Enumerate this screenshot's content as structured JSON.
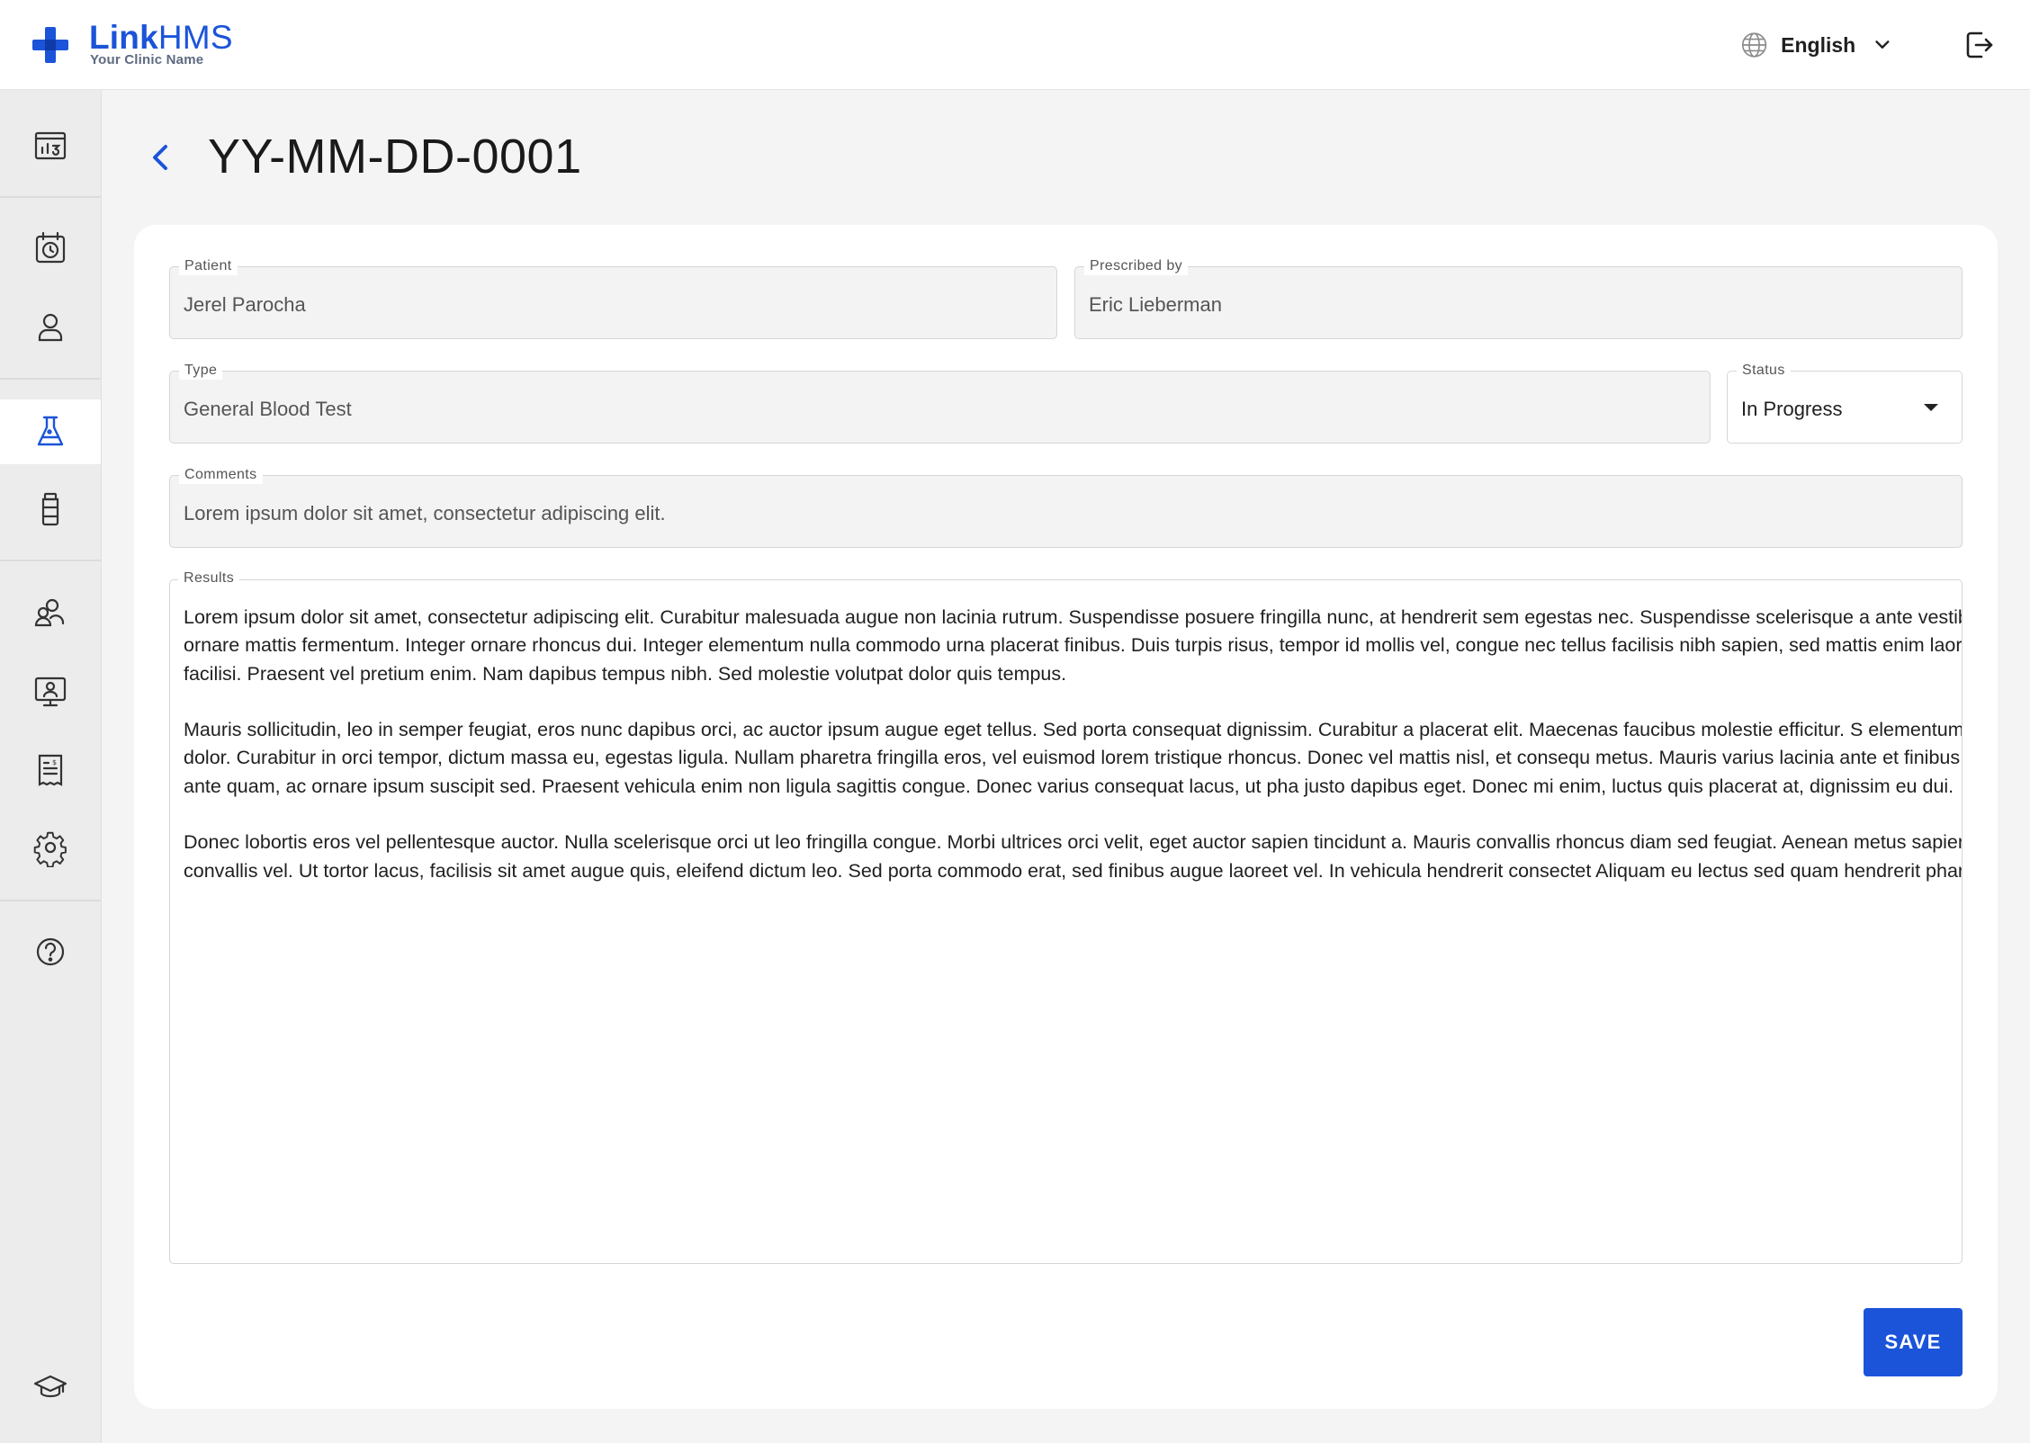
{
  "app": {
    "brand_link": "Link",
    "brand_hms": "HMS",
    "clinic_name": "Your Clinic Name"
  },
  "header": {
    "language": "English"
  },
  "sidebar": {
    "items": [
      {
        "icon": "dashboard-icon"
      },
      {
        "icon": "appointments-icon"
      },
      {
        "icon": "patients-icon"
      },
      {
        "icon": "lab-icon",
        "active": true
      },
      {
        "icon": "pharmacy-icon"
      },
      {
        "icon": "staff-icon"
      },
      {
        "icon": "monitor-icon"
      },
      {
        "icon": "billing-icon"
      },
      {
        "icon": "settings-icon"
      },
      {
        "icon": "help-icon"
      },
      {
        "icon": "education-icon"
      }
    ]
  },
  "page": {
    "title": "YY-MM-DD-0001"
  },
  "form": {
    "patient": {
      "label": "Patient",
      "value": "Jerel Parocha"
    },
    "prescribed_by": {
      "label": "Prescribed by",
      "value": "Eric Lieberman"
    },
    "type": {
      "label": "Type",
      "value": "General Blood Test"
    },
    "status": {
      "label": "Status",
      "value": "In Progress"
    },
    "comments": {
      "label": "Comments",
      "value": "Lorem ipsum dolor sit amet, consectetur adipiscing elit."
    },
    "results": {
      "label": "Results",
      "paragraphs": [
        "Lorem ipsum dolor sit amet, consectetur adipiscing elit. Curabitur malesuada augue non lacinia rutrum. Suspendisse posuere fringilla nunc, at hendrerit sem egestas nec. Suspendisse scelerisque a ante vestibulum mattis. Nulla ornare mattis fermentum. Integer ornare rhoncus dui. Integer elementum nulla commodo urna placerat finibus. Duis turpis risus, tempor id mollis vel, congue nec tellus facilisis nibh sapien, sed mattis enim laoreet sit amet. Nulla facilisi. Praesent vel pretium enim. Nam dapibus tempus nibh. Sed molestie volutpat dolor quis tempus.",
        "Mauris sollicitudin, leo in semper feugiat, eros nunc dapibus orci, ac auctor ipsum augue eget tellus. Sed porta consequat dignissim. Curabitur a placerat elit. Maecenas faucibus molestie efficitur. S elementum neque, sed facilisis dolor. Curabitur in orci tempor, dictum massa eu, egestas ligula. Nullam pharetra fringilla eros, vel euismod lorem tristique rhoncus. Donec vel mattis nisl, et consequ metus. Mauris varius lacinia ante et finibus. Suspendisse vehicula ante quam, ac ornare ipsum suscipit sed. Praesent vehicula enim non ligula sagittis congue. Donec varius consequat lacus, ut pha justo dapibus eget. Donec mi enim, luctus quis placerat at, dignissim eu dui.",
        "Donec lobortis eros vel pellentesque auctor. Nulla scelerisque orci ut leo fringilla congue. Morbi ultrices orci velit, eget auctor sapien tincidunt a. Mauris convallis rhoncus diam sed feugiat. Aenean metus sapien, non rutrum ante convallis vel. Ut tortor lacus, facilisis sit amet augue quis, eleifend dictum leo. Sed porta commodo erat, sed finibus augue laoreet vel. In vehicula hendrerit consectet Aliquam eu lectus sed quam hendrerit pharetra."
      ]
    },
    "save_label": "SAVE"
  },
  "colors": {
    "accent": "#1b54d9",
    "sidebar_bg": "#ececec",
    "page_bg": "#f4f4f4",
    "field_bg": "#f3f3f3"
  }
}
